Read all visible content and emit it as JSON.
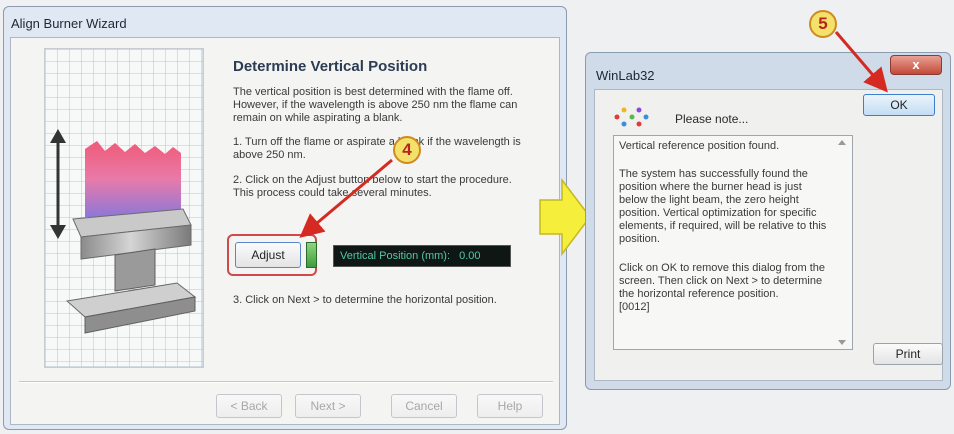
{
  "wizard": {
    "title": "Align Burner Wizard",
    "heading": "Determine Vertical Position",
    "intro": "The vertical position is best determined with the flame off. However, if the wavelength is above 250 nm the flame can remain on while aspirating a blank.",
    "step1": "1. Turn off the flame or aspirate a blank if the wavelength is above 250 nm.",
    "step2": "2. Click on the Adjust button below to start the procedure. This process could take several minutes.",
    "adjust_label": "Adjust",
    "vertical_position_label": "Vertical Position (mm):",
    "vertical_position_value": "0.00",
    "step3": "3. Click on Next > to determine the horizontal position.",
    "buttons": {
      "back": "< Back",
      "next": "Next >",
      "cancel": "Cancel",
      "help": "Help"
    }
  },
  "dialog": {
    "title": "WinLab32",
    "close_label": "x",
    "note_label": "Please note...",
    "ok_label": "OK",
    "print_label": "Print",
    "message": [
      "Vertical reference position found.",
      "The system has successfully found the position where the burner head is just below the light beam, the zero height position. Vertical optimization for specific elements, if required, will be relative to this position.",
      "Click on OK to remove this dialog from the screen. Then click on Next > to determine the horizontal reference position.",
      "[0012]"
    ]
  },
  "callouts": {
    "step4": "4",
    "step5": "5"
  },
  "colors": {
    "callout_fill": "#f4e16a",
    "callout_text": "#b8251e",
    "arrow_red": "#d42a22",
    "transition_arrow": "#f5ef3c",
    "status_display": "#0f1714",
    "status_text": "#53c7a2"
  }
}
